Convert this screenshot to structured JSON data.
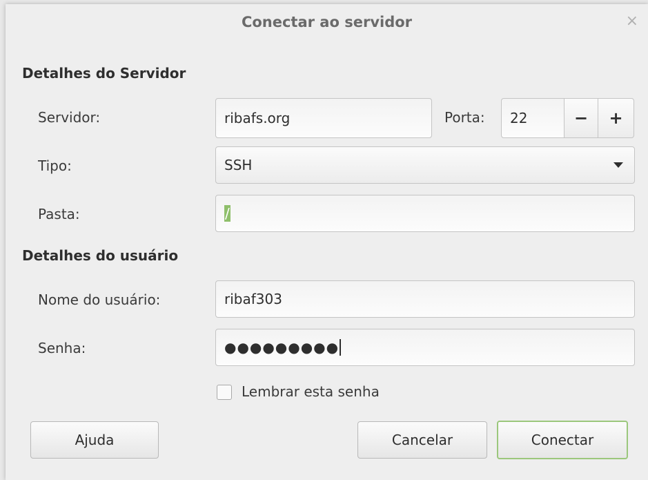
{
  "window": {
    "title": "Conectar ao servidor",
    "close_glyph": "×"
  },
  "server_section": {
    "heading": "Detalhes do Servidor",
    "server_label": "Servidor:",
    "server_value": "ribafs.org",
    "port_label": "Porta:",
    "port_value": "22",
    "port_decrement": "−",
    "port_increment": "+",
    "type_label": "Tipo:",
    "type_value": "SSH",
    "folder_label": "Pasta:",
    "folder_value": "/"
  },
  "user_section": {
    "heading": "Detalhes do usuário",
    "username_label": "Nome do usuário:",
    "username_value": "ribaf303",
    "password_label": "Senha:",
    "password_value": "●●●●●●●●●",
    "remember_label": "Lembrar esta senha",
    "remember_checked": false
  },
  "buttons": {
    "help": "Ajuda",
    "cancel": "Cancelar",
    "connect": "Conectar"
  },
  "colors": {
    "accent": "#8fbf6b",
    "default_border": "#9bc77c"
  }
}
